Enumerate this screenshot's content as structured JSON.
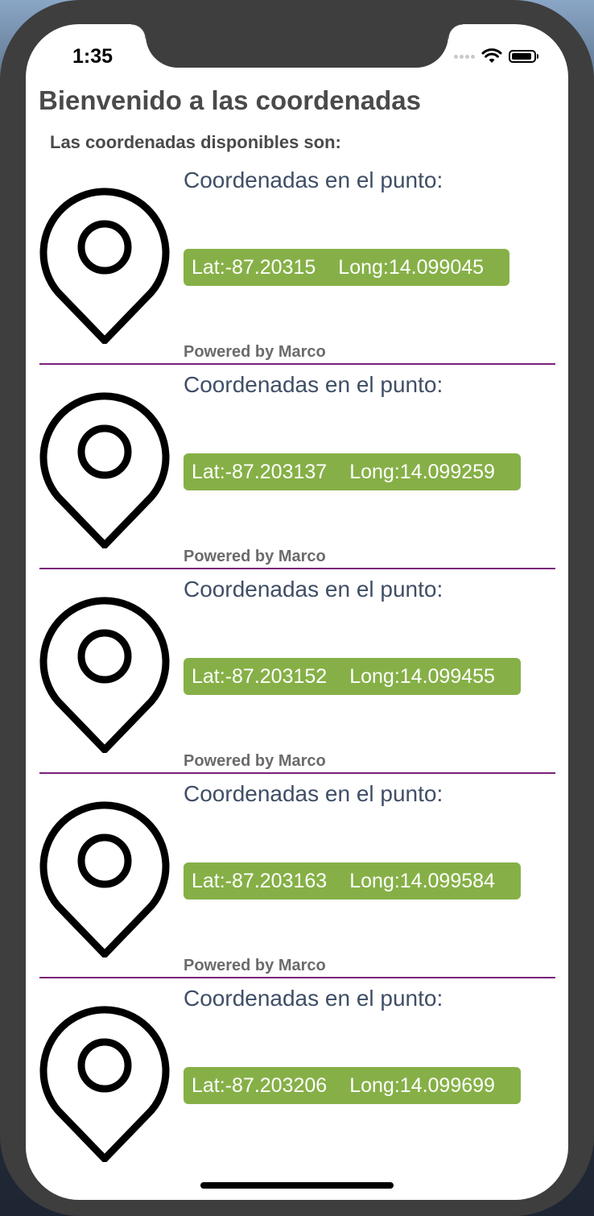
{
  "status_bar": {
    "time": "1:35"
  },
  "header": {
    "title": "Bienvenido a las coordenadas",
    "subtitle": "Las coordenadas disponibles son:"
  },
  "colors": {
    "coord_box": "#86b047",
    "heading_text": "#3f4e66",
    "divider": "#7a1f7a"
  },
  "items": [
    {
      "heading": "Coordenadas en el punto:",
      "lat": "Lat:-87.20315",
      "long": "Long:14.099045",
      "footer": "Powered by Marco",
      "icon": "map-pin-icon"
    },
    {
      "heading": "Coordenadas en el punto:",
      "lat": "Lat:-87.203137",
      "long": "Long:14.099259",
      "footer": "Powered by Marco",
      "icon": "map-pin-icon"
    },
    {
      "heading": "Coordenadas en el punto:",
      "lat": "Lat:-87.203152",
      "long": "Long:14.099455",
      "footer": "Powered by Marco",
      "icon": "map-pin-icon"
    },
    {
      "heading": "Coordenadas en el punto:",
      "lat": "Lat:-87.203163",
      "long": "Long:14.099584",
      "footer": "Powered by Marco",
      "icon": "map-pin-icon"
    },
    {
      "heading": "Coordenadas en el punto:",
      "lat": "Lat:-87.203206",
      "long": "Long:14.099699",
      "icon": "map-pin-icon"
    }
  ]
}
